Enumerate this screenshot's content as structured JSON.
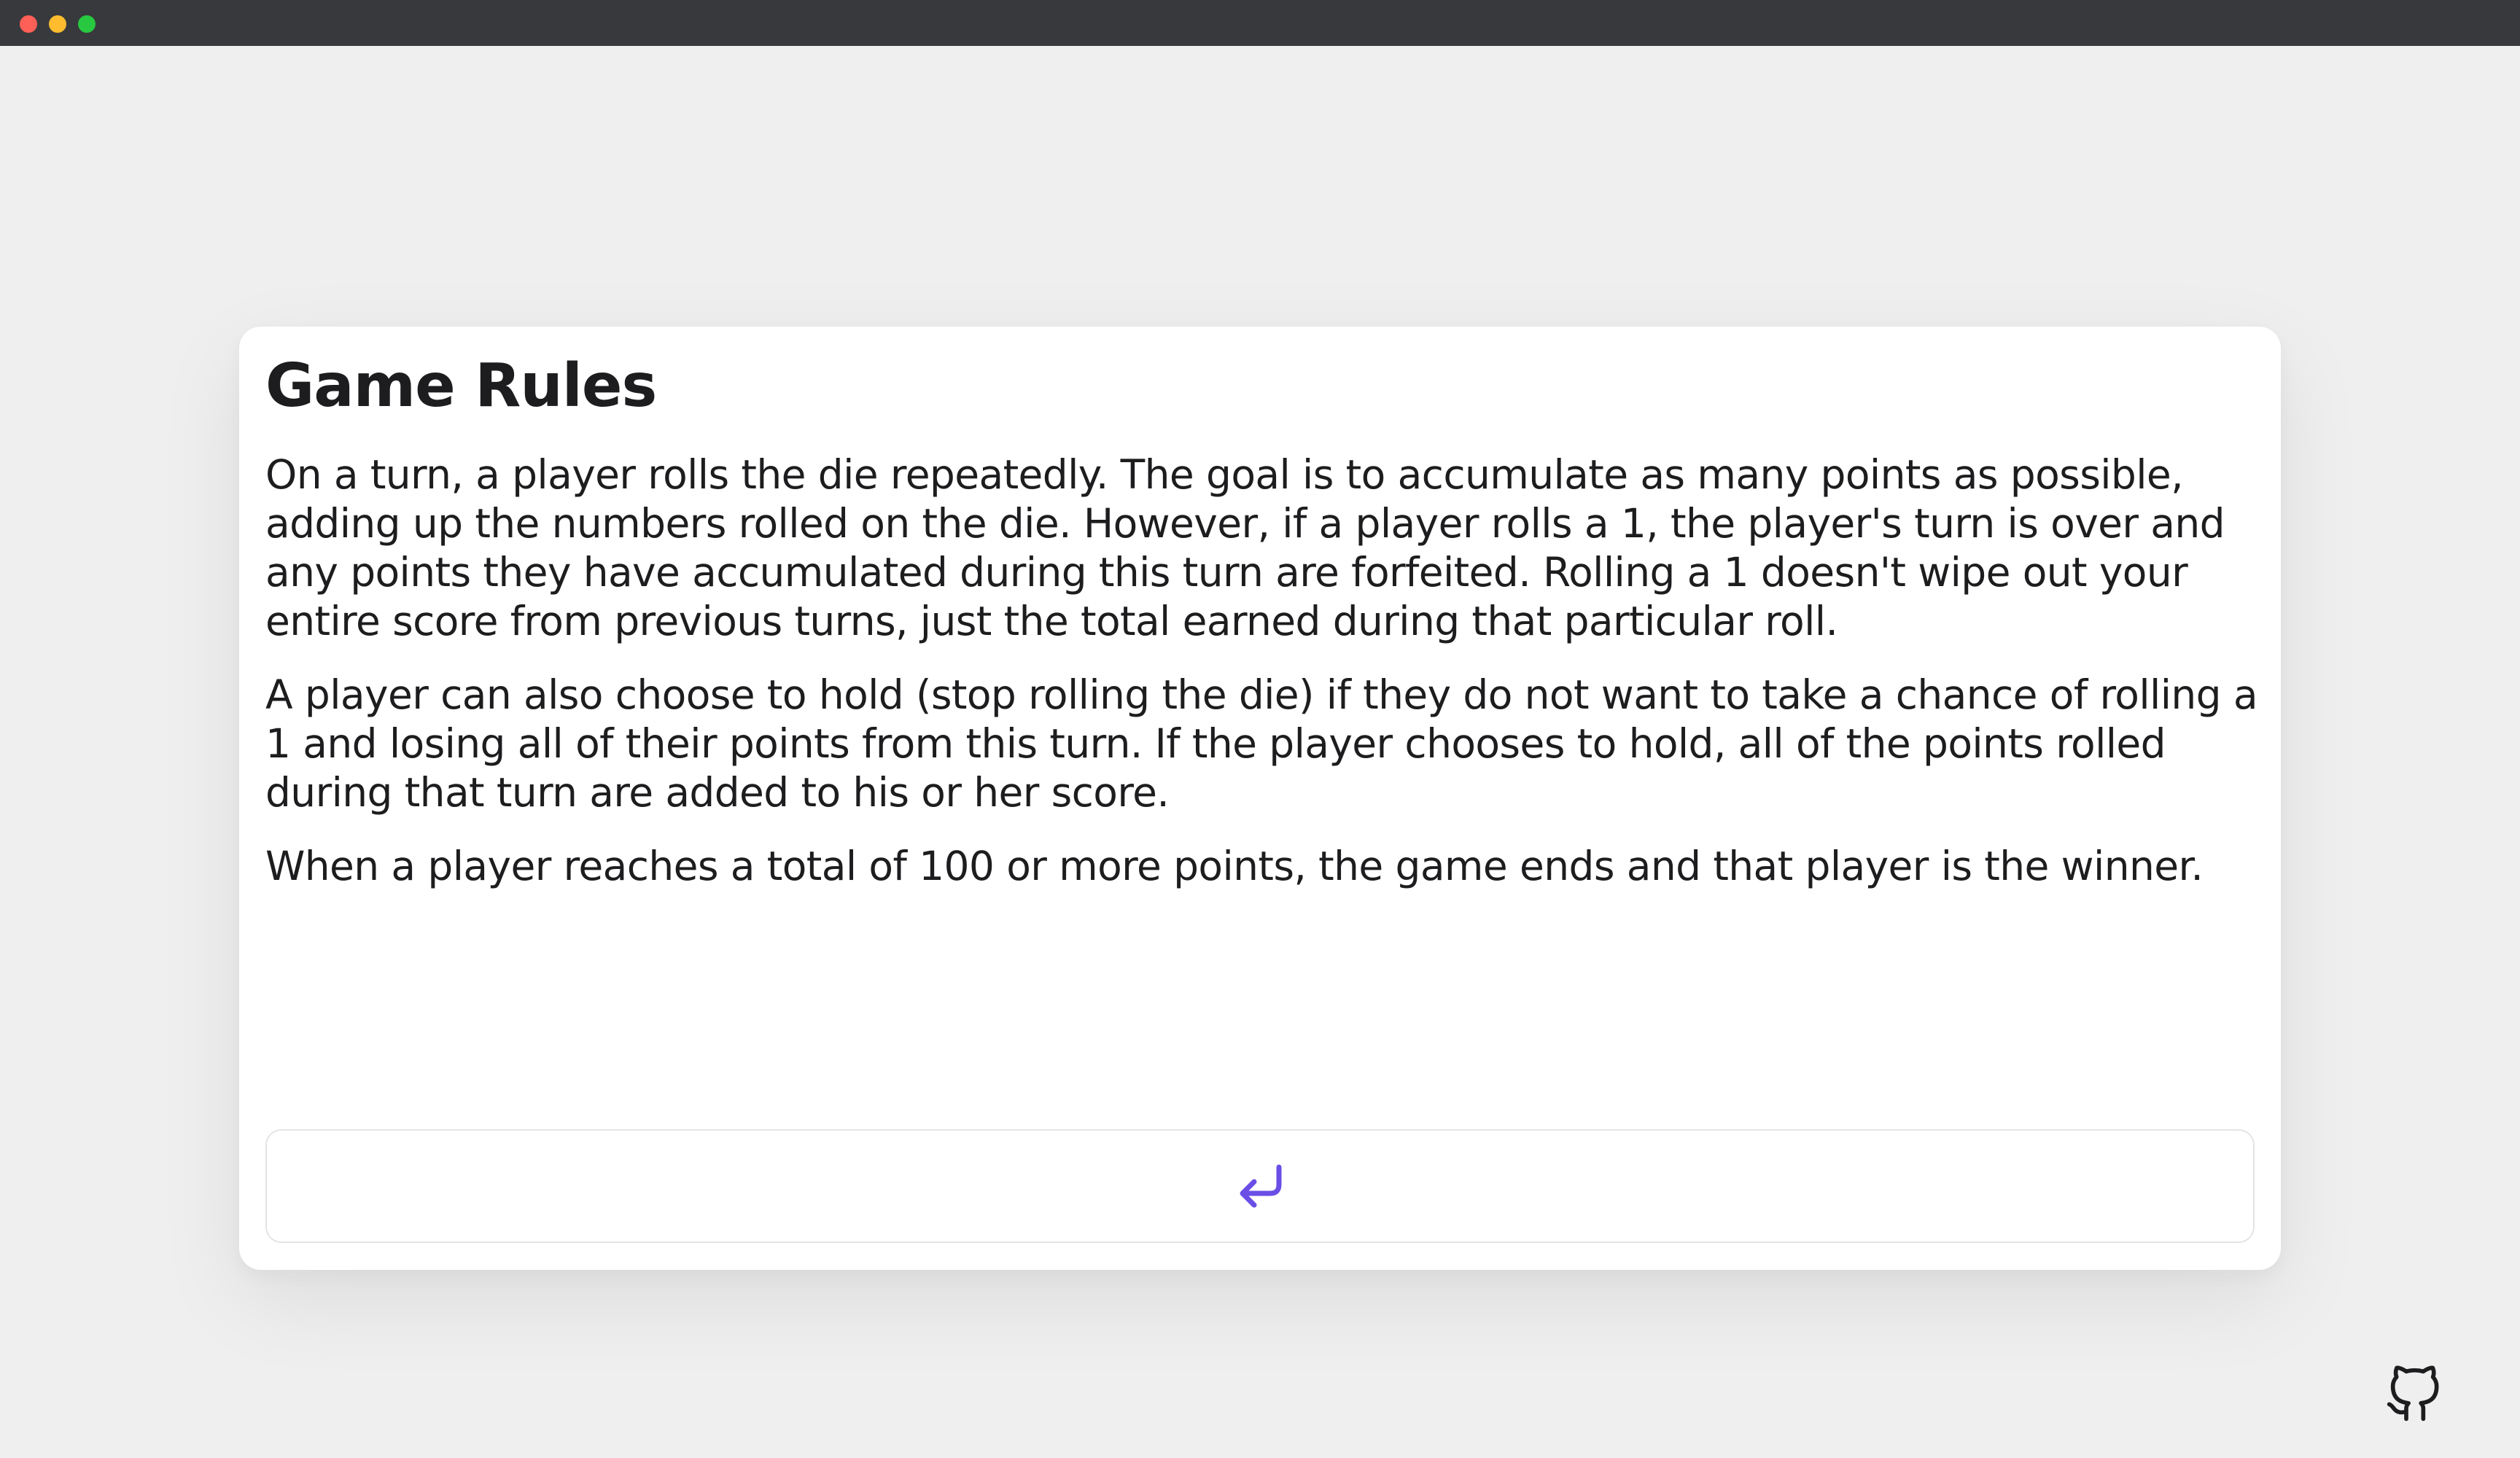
{
  "window": {
    "controls": [
      "close",
      "minimize",
      "zoom"
    ]
  },
  "rules_card": {
    "title": "Game Rules",
    "paragraphs": [
      "On a turn, a player rolls the die repeatedly. The goal is to accumulate as many points as possible, adding up the numbers rolled on the die. However, if a player rolls a 1, the player's turn is over and any points they have accumulated during this turn are forfeited. Rolling a 1 doesn't wipe out your entire score from previous turns, just the total earned during that particular roll.",
      "A player can also choose to hold (stop rolling the die) if they do not want to take a chance of rolling a 1 and losing all of their points from this turn. If the player chooses to hold, all of the points rolled during that turn are added to his or her score.",
      "When a player reaches a total of 100 or more points, the game ends and that player is the winner."
    ],
    "back_button_icon": "return-arrow-icon"
  },
  "footer": {
    "github_icon": "github-icon"
  },
  "colors": {
    "background": "#efefef",
    "card": "#ffffff",
    "text": "#1d1d1f",
    "accent": "#6a4ee6",
    "titlebar": "#38393c"
  }
}
